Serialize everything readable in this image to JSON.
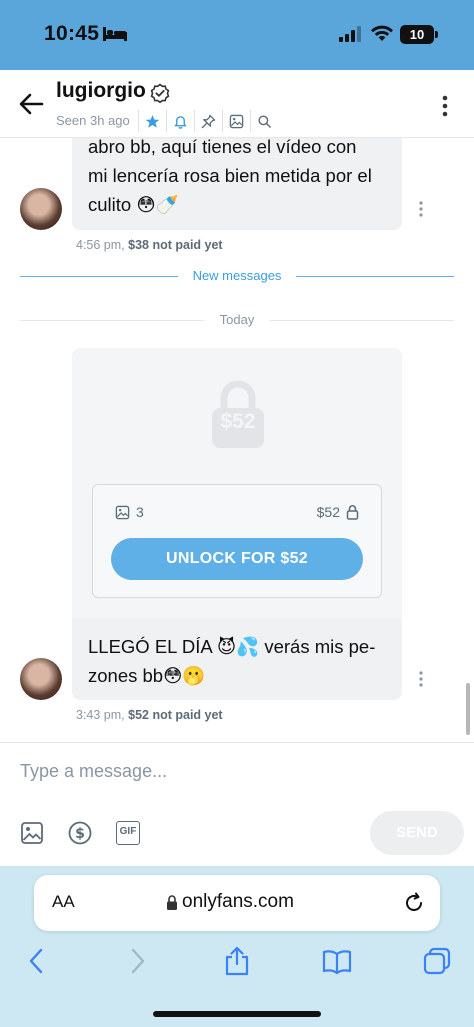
{
  "status_bar": {
    "time": "10:45",
    "battery": "10"
  },
  "header": {
    "username": "lugiorgio",
    "seen": "Seen 3h ago"
  },
  "messages": [
    {
      "lines": [
        "abro bb, aquí tienes el vídeo con",
        "mi lencería rosa bien metida por el",
        "culito 😳🍼"
      ],
      "time": "4:56 pm,",
      "price_status": "$38 not paid yet"
    },
    {
      "lines": [
        "LLEGÓ EL DÍA 😈💦 verás mis pe-",
        "zones bb😳🫢"
      ],
      "time": "3:43 pm,",
      "price_status": "$52 not paid yet"
    }
  ],
  "dividers": {
    "new_messages": "New messages",
    "today": "Today"
  },
  "locked_media": {
    "overlay_price": "$52",
    "media_count": "3",
    "price": "$52",
    "unlock_label": "UNLOCK FOR $52"
  },
  "composer": {
    "placeholder": "Type a message...",
    "send_label": "SEND",
    "gif_label": "GIF"
  },
  "browser": {
    "aa_label": "AA",
    "url": "onlyfans.com"
  },
  "colors": {
    "accent": "#5fb0e6",
    "status_bar": "#5aa6db",
    "browser_bar": "#cde8f2"
  },
  "icons": [
    "bed-icon",
    "signal-icon",
    "wifi-icon",
    "back-arrow-icon",
    "verified-icon",
    "star-icon",
    "bell-icon",
    "pin-icon",
    "image-icon",
    "search-icon",
    "more-vertical-icon",
    "lock-icon",
    "dollar-icon",
    "gif-icon",
    "reload-icon",
    "share-icon",
    "bookmarks-icon",
    "tabs-icon"
  ]
}
